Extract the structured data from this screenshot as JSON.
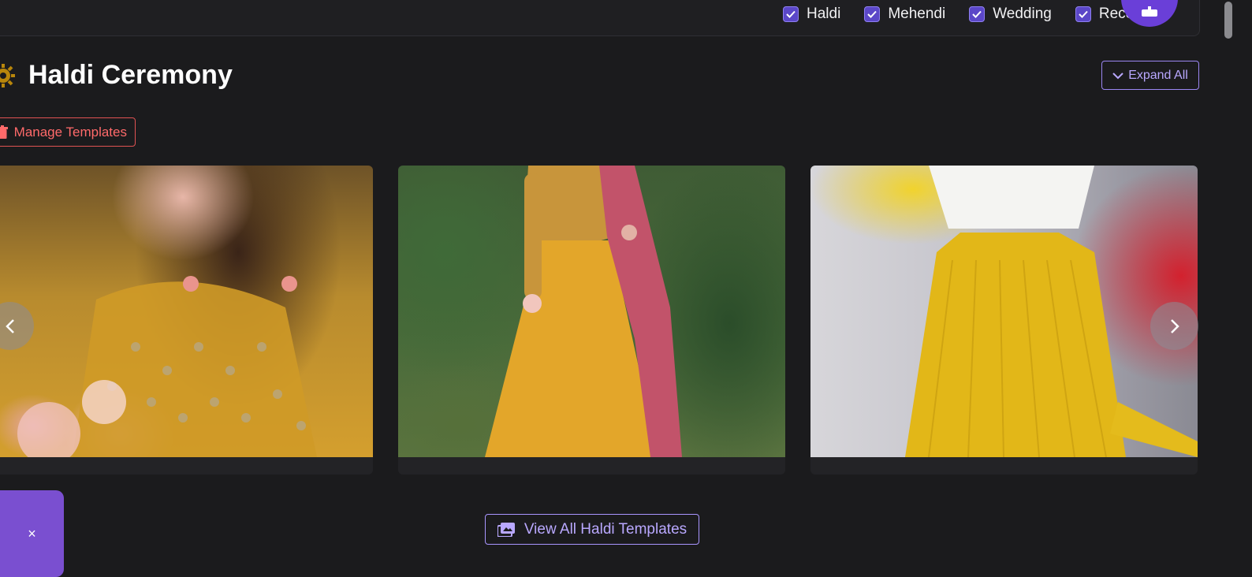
{
  "filters": [
    {
      "label": "Haldi",
      "checked": true
    },
    {
      "label": "Mehendi",
      "checked": true
    },
    {
      "label": "Wedding",
      "checked": true
    },
    {
      "label": "Reception",
      "checked": true
    }
  ],
  "section": {
    "title": "Haldi Ceremony",
    "expand_label": "Expand All",
    "manage_label": "Manage Templates",
    "view_all_label": "View All Haldi Templates"
  },
  "float_panel": {
    "close_glyph": "×"
  },
  "colors": {
    "background": "#1b1b1d",
    "accent": "#9b86f2",
    "danger": "#e05353",
    "checkbox": "#5b47c8",
    "fab": "#6a3fd8"
  },
  "icons": [
    "check-icon",
    "cake-icon",
    "sun-icon",
    "chevron-down-icon",
    "trash-icon",
    "chevron-left-icon",
    "chevron-right-icon",
    "images-icon",
    "close-icon"
  ]
}
